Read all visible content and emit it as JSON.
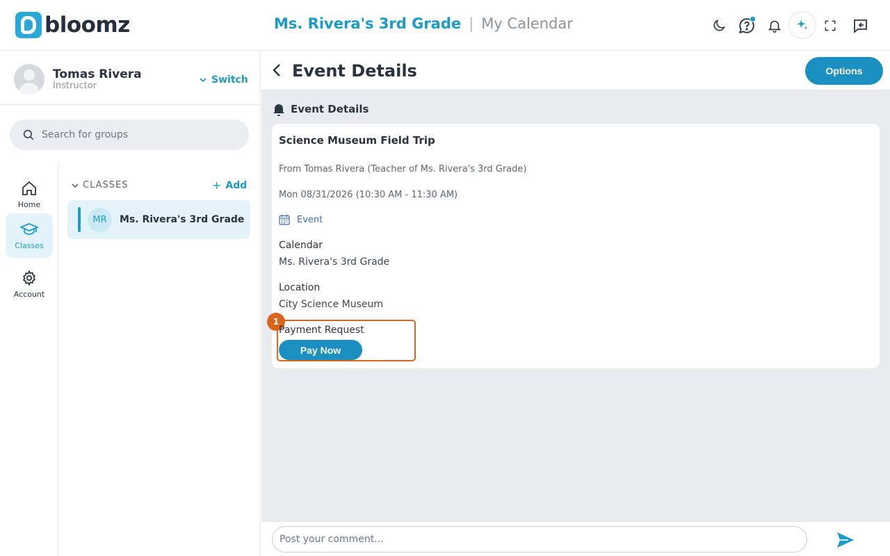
{
  "app": {
    "logo_text": "bloomz"
  },
  "header": {
    "class_name": "Ms. Rivera's 3rd Grade",
    "separator": "|",
    "page_name": "My Calendar",
    "icons": [
      "moon-icon",
      "help-chat-icon",
      "bell-icon",
      "ai-sparkle-icon",
      "fullscreen-icon",
      "collapse-panel-icon"
    ]
  },
  "user": {
    "name": "Tomas Rivera",
    "role": "Instructor",
    "switch_label": "Switch"
  },
  "search": {
    "placeholder": "Search for groups"
  },
  "nav": {
    "items": [
      {
        "label": "Home",
        "icon": "home-icon"
      },
      {
        "label": "Classes",
        "icon": "graduation-cap-icon",
        "active": true
      },
      {
        "label": "Account",
        "icon": "gear-icon"
      }
    ]
  },
  "classes": {
    "header": "CLASSES",
    "add_label": "Add",
    "items": [
      {
        "initials": "MR",
        "name": "Ms. Rivera's 3rd Grade"
      }
    ]
  },
  "main": {
    "title": "Event Details",
    "options_label": "Options",
    "section_header": "Event Details",
    "event": {
      "title": "Science Museum Field Trip",
      "from": "From Tomas Rivera (Teacher of Ms. Rivera's 3rd Grade)",
      "when": "Mon 08/31/2026 (10:30 AM - 11:30 AM)",
      "type": "Event",
      "calendar_label": "Calendar",
      "calendar_value": "Ms. Rivera's 3rd Grade",
      "location_label": "Location",
      "location_value": "City Science Museum",
      "payment_label": "Payment Request",
      "pay_button": "Pay Now",
      "highlight_badge": "1"
    },
    "comment": {
      "placeholder": "Post your comment..."
    }
  },
  "colors": {
    "accent": "#1b9cc7",
    "button": "#1b8fbf",
    "highlight": "#d9661d",
    "main_bg": "#e8ecf1"
  }
}
